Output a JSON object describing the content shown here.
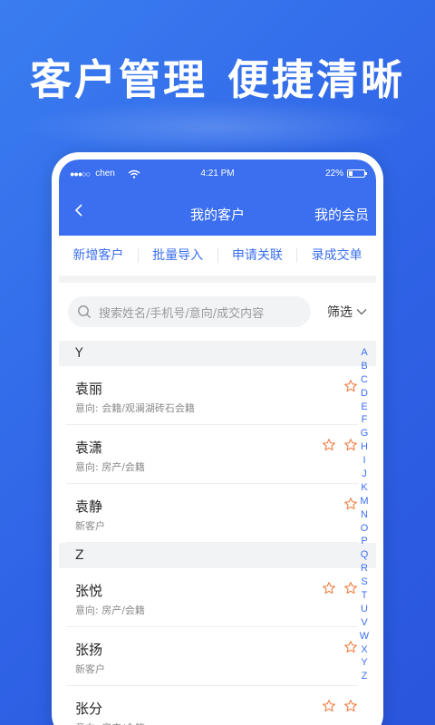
{
  "hero": {
    "title_a": "客户管理",
    "title_b": "便捷清晰"
  },
  "status_bar": {
    "carrier": "chen",
    "time": "4:21 PM",
    "battery": "22%"
  },
  "nav": {
    "title": "我的客户",
    "right_label": "我的会员"
  },
  "actions": [
    "新增客户",
    "批量导入",
    "申请关联",
    "录成交单"
  ],
  "search": {
    "placeholder": "搜索姓名/手机号/意向/成交内容",
    "filter_label": "筛选"
  },
  "sections": [
    {
      "letter": "Y",
      "customers": [
        {
          "name": "袁丽",
          "detail": "意向: 会籍/观澜湖砖石会籍",
          "stars": 1
        },
        {
          "name": "袁潇",
          "detail": "意向: 房产/会籍",
          "stars": 2
        },
        {
          "name": "袁静",
          "detail": "新客户",
          "stars": 1
        }
      ]
    },
    {
      "letter": "Z",
      "customers": [
        {
          "name": "张悦",
          "detail": "意向: 房产/会籍",
          "stars": 2
        },
        {
          "name": "张扬",
          "detail": "新客户",
          "stars": 1
        },
        {
          "name": "张分",
          "detail": "意向: 房产/会籍",
          "stars": 2
        }
      ]
    }
  ],
  "alphabet_index": [
    "A",
    "B",
    "C",
    "D",
    "E",
    "F",
    "G",
    "H",
    "I",
    "J",
    "K",
    "M",
    "N",
    "O",
    "P",
    "Q",
    "R",
    "S",
    "T",
    "U",
    "V",
    "W",
    "X",
    "Y",
    "Z"
  ],
  "colors": {
    "primary": "#3b6ff0",
    "star": "#f07a3c",
    "background": "#2f63e6"
  },
  "icons": {
    "back": "chevron-left-icon",
    "search": "search-icon",
    "filter": "chevron-down-icon",
    "star": "star-outline-icon",
    "wifi": "wifi-icon",
    "battery": "battery-icon"
  }
}
